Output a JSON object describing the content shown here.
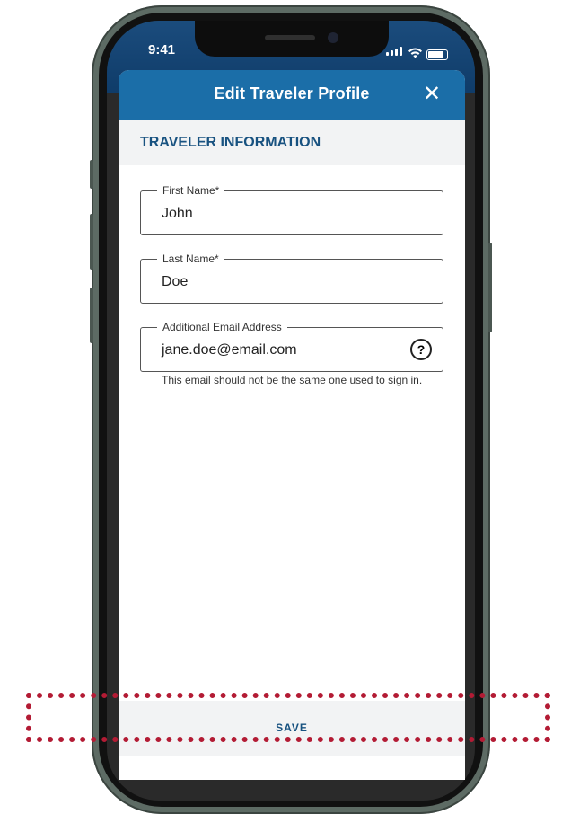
{
  "status_bar": {
    "time": "9:41",
    "icons": [
      "cellular-signal-icon",
      "wifi-icon",
      "battery-icon"
    ]
  },
  "header": {
    "title": "Edit Traveler Profile",
    "close_icon": "close-icon",
    "close_glyph": "✕"
  },
  "section": {
    "title": "TRAVELER INFORMATION"
  },
  "form": {
    "first_name": {
      "label": "First Name*",
      "value": "John"
    },
    "last_name": {
      "label": "Last Name*",
      "value": "Doe"
    },
    "email": {
      "label": "Additional Email Address",
      "value": "jane.doe@email.com",
      "help_icon": "help-icon",
      "help_glyph": "?",
      "helper_text": "This email should not be the same one used to sign in."
    }
  },
  "footer": {
    "save_label": "SAVE"
  },
  "colors": {
    "header_bg": "#1b6ea8",
    "accent_text": "#185280",
    "highlight": "#b31b34",
    "band_bg": "#f2f3f4"
  }
}
